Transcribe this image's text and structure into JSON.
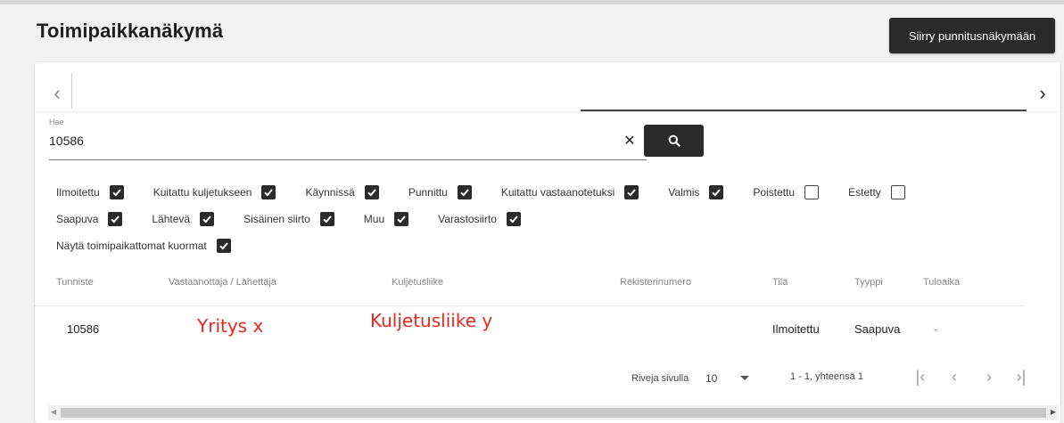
{
  "header": {
    "title": "Toimipaikkanäkymä",
    "weigh_button": "Siirry punnitusnäkymään"
  },
  "search": {
    "label": "Hae",
    "value": "10586"
  },
  "filters": {
    "row1": [
      {
        "label": "Ilmoitettu",
        "checked": true
      },
      {
        "label": "Kuitattu kuljetukseen",
        "checked": true
      },
      {
        "label": "Käynnissä",
        "checked": true
      },
      {
        "label": "Punnittu",
        "checked": true
      },
      {
        "label": "Kuitattu vastaanotetuksi",
        "checked": true
      },
      {
        "label": "Valmis",
        "checked": true
      },
      {
        "label": "Poistettu",
        "checked": false
      },
      {
        "label": "Estetty",
        "checked": false
      }
    ],
    "row2": [
      {
        "label": "Saapuva",
        "checked": true
      },
      {
        "label": "Lähtevä",
        "checked": true
      },
      {
        "label": "Sisäinen siirto",
        "checked": true
      },
      {
        "label": "Muu",
        "checked": true
      },
      {
        "label": "Varastosiirto",
        "checked": true
      }
    ],
    "row3": [
      {
        "label": "Näytä toimipaikattomat kuormat",
        "checked": true
      }
    ]
  },
  "table": {
    "columns": [
      "Tunniste",
      "Vastaanottaja / Lähettäjä",
      "Kuljetusliike",
      "Rekisterinumero",
      "Tila",
      "Tyyppi",
      "Tuloaika"
    ],
    "rows": [
      {
        "tunniste": "10586",
        "vastaanottaja": "Yritys x",
        "kuljetusliike": "Kuljetusliike y",
        "rekisterinumero": "",
        "tila": "Ilmoitettu",
        "tyyppi": "Saapuva",
        "tuloaika": "-"
      }
    ]
  },
  "pagination": {
    "rows_per_page_label": "Riveja sivulla",
    "rows_per_page_value": "10",
    "range": "1 - 1, yhteensä 1"
  },
  "colors": {
    "annotation": "#e8281e",
    "dark_button": "#2a2a2a"
  }
}
